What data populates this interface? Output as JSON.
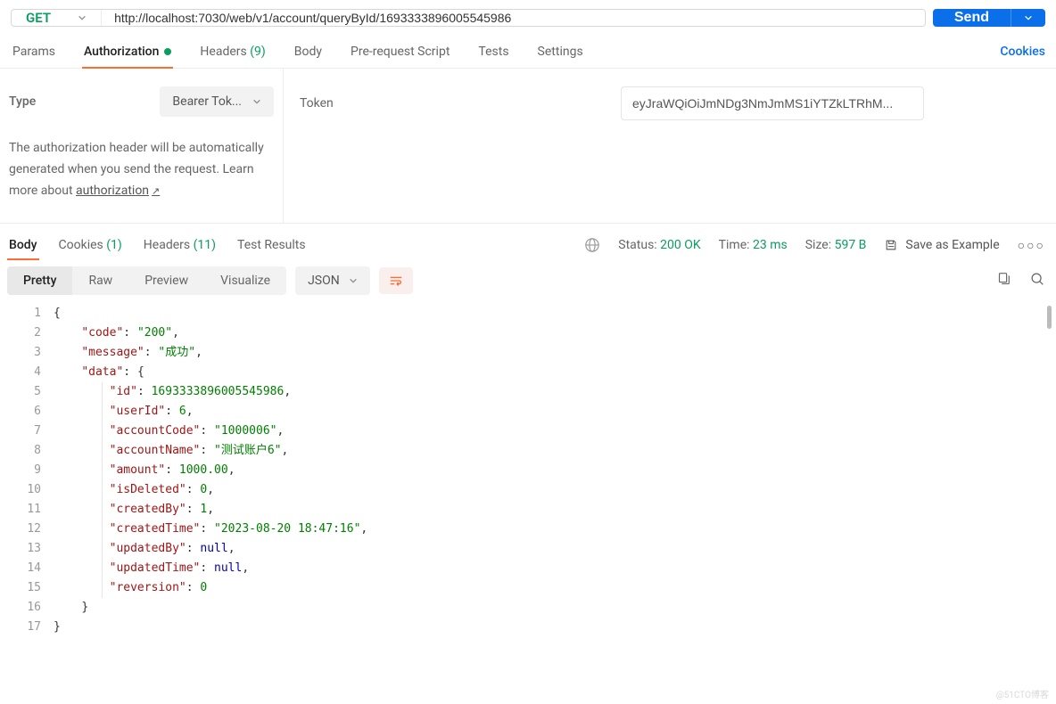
{
  "request": {
    "method": "GET",
    "url": "http://localhost:7030/web/v1/account/queryById/1693333896005545986",
    "send_label": "Send"
  },
  "tabs": {
    "params": "Params",
    "authorization": "Authorization",
    "headers": "Headers",
    "headers_count": "(9)",
    "body": "Body",
    "prerequest": "Pre-request Script",
    "tests": "Tests",
    "settings": "Settings",
    "cookies": "Cookies"
  },
  "auth": {
    "type_label": "Type",
    "type_value": "Bearer Tok...",
    "desc_1": "The authorization header will be automatically generated when you send the request. Learn more about ",
    "desc_link": "authorization",
    "token_label": "Token",
    "token_value": "eyJraWQiOiJmNDg3NmJmMS1iYTZkLTRhM..."
  },
  "response": {
    "tabs": {
      "body": "Body",
      "cookies": "Cookies",
      "cookies_count": "(1)",
      "headers": "Headers",
      "headers_count": "(11)",
      "test_results": "Test Results"
    },
    "status_label": "Status:",
    "status_value": "200 OK",
    "time_label": "Time:",
    "time_value": "23 ms",
    "size_label": "Size:",
    "size_value": "597 B",
    "save_example": "Save as Example"
  },
  "view": {
    "pretty": "Pretty",
    "raw": "Raw",
    "preview": "Preview",
    "visualize": "Visualize",
    "format": "JSON"
  },
  "json_lines": [
    {
      "n": 1,
      "indent": 0,
      "text": "{"
    },
    {
      "n": 2,
      "indent": 1,
      "key": "code",
      "val": "\"200\"",
      "type": "s",
      "comma": true
    },
    {
      "n": 3,
      "indent": 1,
      "key": "message",
      "val": "\"成功\"",
      "type": "s",
      "comma": true
    },
    {
      "n": 4,
      "indent": 1,
      "key": "data",
      "val": "{",
      "type": "p"
    },
    {
      "n": 5,
      "indent": 2,
      "key": "id",
      "val": "1693333896005545986",
      "type": "n",
      "comma": true
    },
    {
      "n": 6,
      "indent": 2,
      "key": "userId",
      "val": "6",
      "type": "n",
      "comma": true
    },
    {
      "n": 7,
      "indent": 2,
      "key": "accountCode",
      "val": "\"1000006\"",
      "type": "s",
      "comma": true
    },
    {
      "n": 8,
      "indent": 2,
      "key": "accountName",
      "val": "\"测试账户6\"",
      "type": "s",
      "comma": true
    },
    {
      "n": 9,
      "indent": 2,
      "key": "amount",
      "val": "1000.00",
      "type": "n",
      "comma": true
    },
    {
      "n": 10,
      "indent": 2,
      "key": "isDeleted",
      "val": "0",
      "type": "n",
      "comma": true
    },
    {
      "n": 11,
      "indent": 2,
      "key": "createdBy",
      "val": "1",
      "type": "n",
      "comma": true
    },
    {
      "n": 12,
      "indent": 2,
      "key": "createdTime",
      "val": "\"2023-08-20 18:47:16\"",
      "type": "s",
      "comma": true
    },
    {
      "n": 13,
      "indent": 2,
      "key": "updatedBy",
      "val": "null",
      "type": "nullv",
      "comma": true
    },
    {
      "n": 14,
      "indent": 2,
      "key": "updatedTime",
      "val": "null",
      "type": "nullv",
      "comma": true
    },
    {
      "n": 15,
      "indent": 2,
      "key": "reversion",
      "val": "0",
      "type": "n"
    },
    {
      "n": 16,
      "indent": 1,
      "text": "}"
    },
    {
      "n": 17,
      "indent": 0,
      "text": "}"
    }
  ],
  "watermark": "@51CTO博客"
}
